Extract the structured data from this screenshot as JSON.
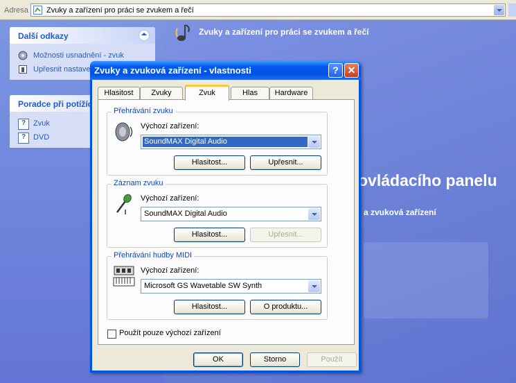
{
  "address_bar": {
    "label": "Adresa",
    "value": "Zvuky a zařízení pro práci se zvukem a řečí"
  },
  "left_pane": {
    "see_also": {
      "title": "Další odkazy",
      "items": [
        {
          "label": "Možnosti usnadnění - zvuk",
          "icon": "accessibility-icon"
        },
        {
          "label": "Upřesnit nastavení",
          "icon": "advanced-icon"
        }
      ]
    },
    "troubleshoot": {
      "title": "Poradce při potížích",
      "items": [
        {
          "label": "Zvuk",
          "icon": "help-icon"
        },
        {
          "label": "DVD",
          "icon": "help-icon"
        }
      ]
    }
  },
  "main": {
    "title": "Zvuky a zařízení pro práci se zvukem a řečí",
    "big_text": "ovládacího panelu",
    "small_text": "a zvuková zařízení"
  },
  "dialog": {
    "title": "Zvuky a zvuková zařízení - vlastnosti",
    "tabs": [
      "Hlasitost",
      "Zvuky",
      "Zvuk",
      "Hlas",
      "Hardware"
    ],
    "active_tab": "Zvuk",
    "playback": {
      "title": "Přehrávání zvuku",
      "device_label": "Výchozí zařízení:",
      "device": "SoundMAX Digital Audio",
      "volume_button": "Hlasitost...",
      "advanced_button": "Upřesnit..."
    },
    "recording": {
      "title": "Záznam zvuku",
      "device_label": "Výchozí zařízení:",
      "device": "SoundMAX Digital Audio",
      "volume_button": "Hlasitost...",
      "advanced_button": "Upřesnit..."
    },
    "midi": {
      "title": "Přehrávání hudby MIDI",
      "device_label": "Výchozí zařízení:",
      "device": "Microsoft GS Wavetable SW Synth",
      "volume_button": "Hlasitost...",
      "about_button": "O produktu..."
    },
    "use_default_only": "Použít pouze výchozí zařízení",
    "ok": "OK",
    "cancel": "Storno",
    "apply": "Použít"
  },
  "colors": {
    "xp_blue": "#0054e3",
    "panel_bg": "#ece9d8",
    "link": "#215dc6",
    "selection": "#316ac5"
  }
}
